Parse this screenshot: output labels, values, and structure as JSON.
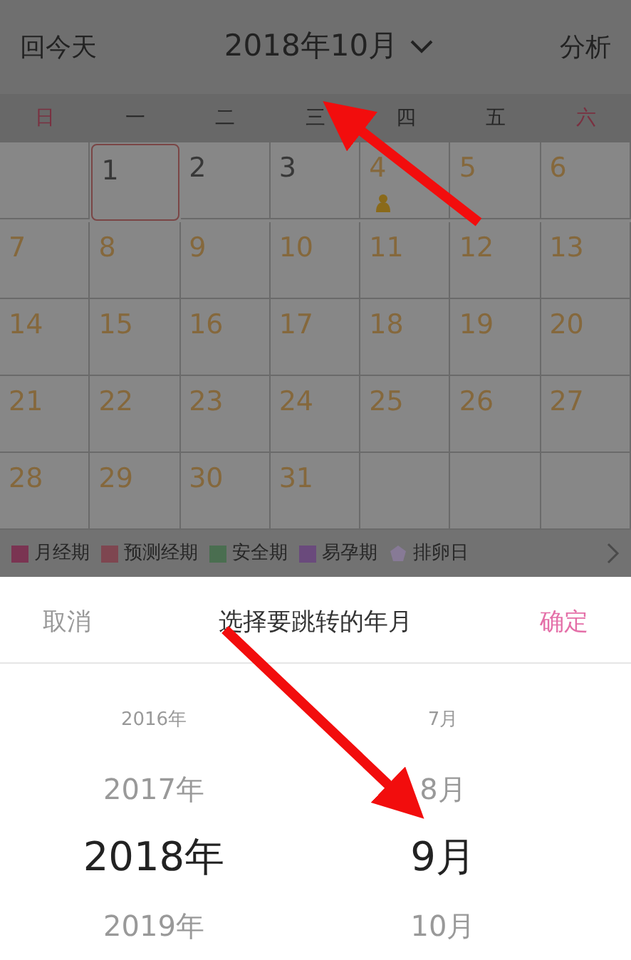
{
  "header": {
    "today_button": "回今天",
    "month_title": "2018年10月",
    "analysis_button": "分析"
  },
  "weekdays": [
    {
      "label": "日",
      "weekend": true
    },
    {
      "label": "一",
      "weekend": false
    },
    {
      "label": "二",
      "weekend": false
    },
    {
      "label": "三",
      "weekend": false
    },
    {
      "label": "四",
      "weekend": false
    },
    {
      "label": "五",
      "weekend": false
    },
    {
      "label": "六",
      "weekend": true
    }
  ],
  "weeks": [
    [
      {
        "kind": "empty"
      },
      {
        "kind": "day",
        "day": "1",
        "color": "#383838",
        "today": true,
        "marker": false
      },
      {
        "kind": "day",
        "day": "2",
        "color": "#383838",
        "today": false,
        "marker": false
      },
      {
        "kind": "day",
        "day": "3",
        "color": "#383838",
        "today": false,
        "marker": false
      },
      {
        "kind": "day",
        "day": "4",
        "color": "#85683c",
        "today": false,
        "marker": true
      },
      {
        "kind": "day",
        "day": "5",
        "color": "#85683c",
        "today": false,
        "marker": false
      },
      {
        "kind": "day",
        "day": "6",
        "color": "#85683c",
        "today": false,
        "marker": false
      }
    ],
    [
      {
        "kind": "day",
        "day": "7",
        "color": "#85683c",
        "today": false,
        "marker": false
      },
      {
        "kind": "day",
        "day": "8",
        "color": "#85683c",
        "today": false,
        "marker": false
      },
      {
        "kind": "day",
        "day": "9",
        "color": "#85683c",
        "today": false,
        "marker": false
      },
      {
        "kind": "day",
        "day": "10",
        "color": "#85683c",
        "today": false,
        "marker": false
      },
      {
        "kind": "day",
        "day": "11",
        "color": "#85683c",
        "today": false,
        "marker": false
      },
      {
        "kind": "day",
        "day": "12",
        "color": "#85683c",
        "today": false,
        "marker": false
      },
      {
        "kind": "day",
        "day": "13",
        "color": "#85683c",
        "today": false,
        "marker": false
      }
    ],
    [
      {
        "kind": "day",
        "day": "14",
        "color": "#85683c",
        "today": false,
        "marker": false
      },
      {
        "kind": "day",
        "day": "15",
        "color": "#85683c",
        "today": false,
        "marker": false
      },
      {
        "kind": "day",
        "day": "16",
        "color": "#85683c",
        "today": false,
        "marker": false
      },
      {
        "kind": "day",
        "day": "17",
        "color": "#85683c",
        "today": false,
        "marker": false
      },
      {
        "kind": "day",
        "day": "18",
        "color": "#85683c",
        "today": false,
        "marker": false
      },
      {
        "kind": "day",
        "day": "19",
        "color": "#85683c",
        "today": false,
        "marker": false
      },
      {
        "kind": "day",
        "day": "20",
        "color": "#85683c",
        "today": false,
        "marker": false
      }
    ],
    [
      {
        "kind": "day",
        "day": "21",
        "color": "#85683c",
        "today": false,
        "marker": false
      },
      {
        "kind": "day",
        "day": "22",
        "color": "#85683c",
        "today": false,
        "marker": false
      },
      {
        "kind": "day",
        "day": "23",
        "color": "#85683c",
        "today": false,
        "marker": false
      },
      {
        "kind": "day",
        "day": "24",
        "color": "#85683c",
        "today": false,
        "marker": false
      },
      {
        "kind": "day",
        "day": "25",
        "color": "#85683c",
        "today": false,
        "marker": false
      },
      {
        "kind": "day",
        "day": "26",
        "color": "#85683c",
        "today": false,
        "marker": false
      },
      {
        "kind": "day",
        "day": "27",
        "color": "#85683c",
        "today": false,
        "marker": false
      }
    ],
    [
      {
        "kind": "day",
        "day": "28",
        "color": "#85683c",
        "today": false,
        "marker": false
      },
      {
        "kind": "day",
        "day": "29",
        "color": "#85683c",
        "today": false,
        "marker": false
      },
      {
        "kind": "day",
        "day": "30",
        "color": "#85683c",
        "today": false,
        "marker": false
      },
      {
        "kind": "day",
        "day": "31",
        "color": "#85683c",
        "today": false,
        "marker": false
      },
      {
        "kind": "empty"
      },
      {
        "kind": "empty"
      },
      {
        "kind": "empty"
      }
    ]
  ],
  "legend": [
    {
      "label": "月经期",
      "kind": "square",
      "color": "#7a3452"
    },
    {
      "label": "预测经期",
      "kind": "square",
      "color": "#7e4650"
    },
    {
      "label": "安全期",
      "kind": "square",
      "color": "#4a6e50"
    },
    {
      "label": "易孕期",
      "kind": "square",
      "color": "#6a4a7c"
    },
    {
      "label": "排卵日",
      "kind": "flower",
      "color": "#877a96"
    }
  ],
  "picker": {
    "cancel": "取消",
    "title": "选择要跳转的年月",
    "confirm": "确定",
    "years": [
      {
        "label": "2016年",
        "selected": false
      },
      {
        "label": "2017年",
        "selected": false
      },
      {
        "label": "2018年",
        "selected": true
      },
      {
        "label": "2019年",
        "selected": false
      }
    ],
    "months": [
      {
        "label": "7月",
        "selected": false
      },
      {
        "label": "8月",
        "selected": false
      },
      {
        "label": "9月",
        "selected": true
      },
      {
        "label": "10月",
        "selected": false
      }
    ]
  }
}
